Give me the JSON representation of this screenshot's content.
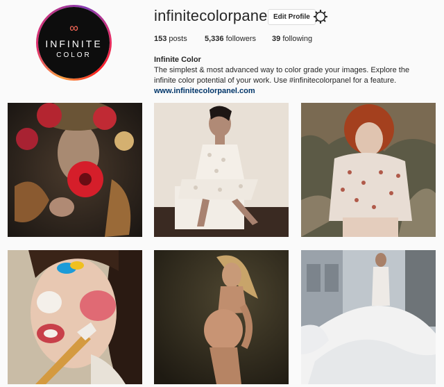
{
  "profile": {
    "username": "infinitecolorpanel",
    "edit_label": "Edit Profile",
    "avatar": {
      "logo_symbol": "∞",
      "logo_line1": "INFINITE",
      "logo_line2": "COLOR"
    },
    "stats": [
      {
        "count": "153",
        "label": "posts"
      },
      {
        "count": "5,336",
        "label": "followers"
      },
      {
        "count": "39",
        "label": "following"
      }
    ],
    "bio": {
      "name": "Infinite Color",
      "text": "The simplest & most advanced way to color grade your images. Explore the infinite color potential of your work. Use #infinitecolorpanel for a feature.",
      "website": "www.infinitecolorpanel.com"
    }
  },
  "posts": [
    {
      "icon": "floral-crown-portrait-photo"
    },
    {
      "icon": "white-lace-dress-photo"
    },
    {
      "icon": "red-hair-floral-blouse-photo"
    },
    {
      "icon": "paint-face-portrait-photo"
    },
    {
      "icon": "maternity-portrait-photo"
    },
    {
      "icon": "bridal-tulle-gown-photo"
    }
  ]
}
